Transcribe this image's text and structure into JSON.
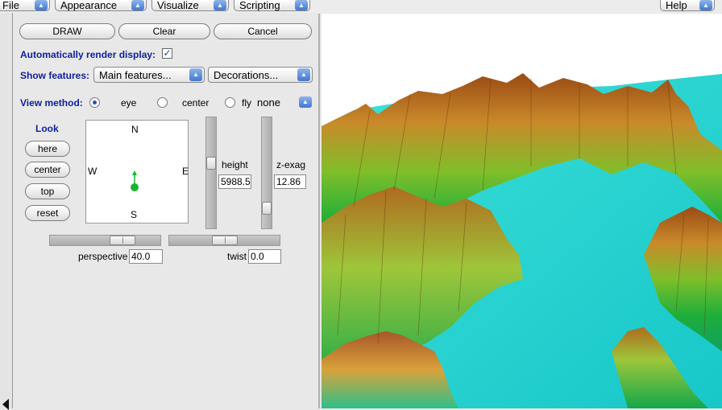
{
  "menubar": {
    "file": "File",
    "appearance": "Appearance",
    "visualize": "Visualize",
    "scripting": "Scripting",
    "help": "Help"
  },
  "buttons": {
    "draw": "DRAW",
    "clear": "Clear",
    "cancel": "Cancel"
  },
  "auto_render": {
    "label": "Automatically render display:",
    "checked": true
  },
  "show_features": {
    "label": "Show features:",
    "main": "Main features...",
    "decorations": "Decorations..."
  },
  "view_method": {
    "label": "View method:",
    "eye": "eye",
    "center": "center",
    "fly": "fly",
    "fly_mode": "none",
    "selected": "eye"
  },
  "look": {
    "label": "Look",
    "here": "here",
    "center": "center",
    "top": "top",
    "reset": "reset"
  },
  "compass": {
    "n": "N",
    "s": "S",
    "e": "E",
    "w": "W"
  },
  "height": {
    "label": "height",
    "value": "5988.5"
  },
  "zexag": {
    "label": "z-exag",
    "value": "12.86"
  },
  "perspective": {
    "label": "perspective",
    "value": "40.0"
  },
  "twist": {
    "label": "twist",
    "value": "0.0"
  },
  "colors": {
    "label_blue": "#0d1f9e",
    "accent": "#3f78d1",
    "compass_dot": "#17b52a"
  }
}
